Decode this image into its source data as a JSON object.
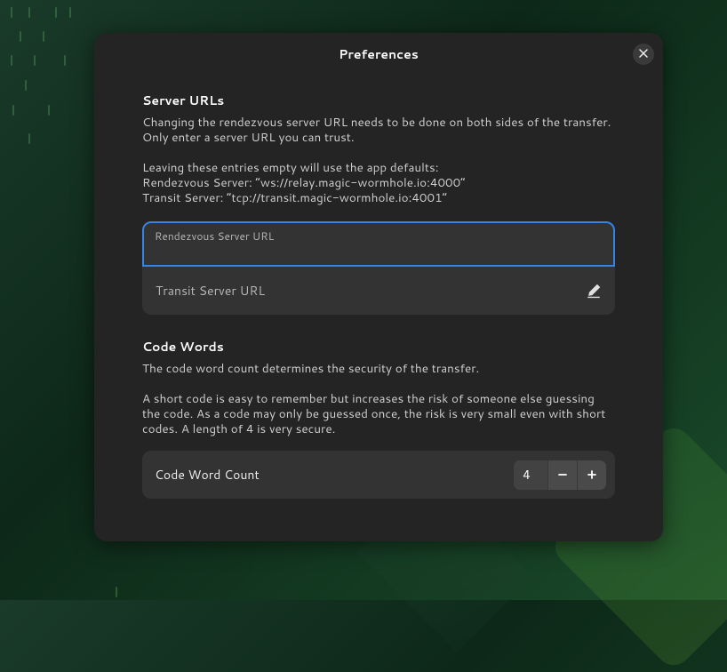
{
  "dialog": {
    "title": "Preferences",
    "close_label": "×"
  },
  "server_urls": {
    "title": "Server URLs",
    "desc1": "Changing the rendezvous server URL needs to be done on both sides of the transfer. Only enter a server URL you can trust.",
    "desc2_line1": "Leaving these entries empty will use the app defaults:",
    "desc2_line2": "Rendezvous Server: “ws://relay.magic-wormhole.io:4000”",
    "desc2_line3": "Transit Server: “tcp://transit.magic-wormhole.io:4001”",
    "rendezvous_label": "Rendezvous Server URL",
    "rendezvous_value": "",
    "transit_label": "Transit Server URL"
  },
  "code_words": {
    "title": "Code Words",
    "desc1": "The code word count determines the security of the transfer.",
    "desc2": "A short code is easy to remember but increases the risk of someone else guessing the code. As a code may only be guessed once, the risk is very small even with short codes. A length of 4 is very secure.",
    "count_label": "Code Word Count",
    "count_value": "4"
  }
}
